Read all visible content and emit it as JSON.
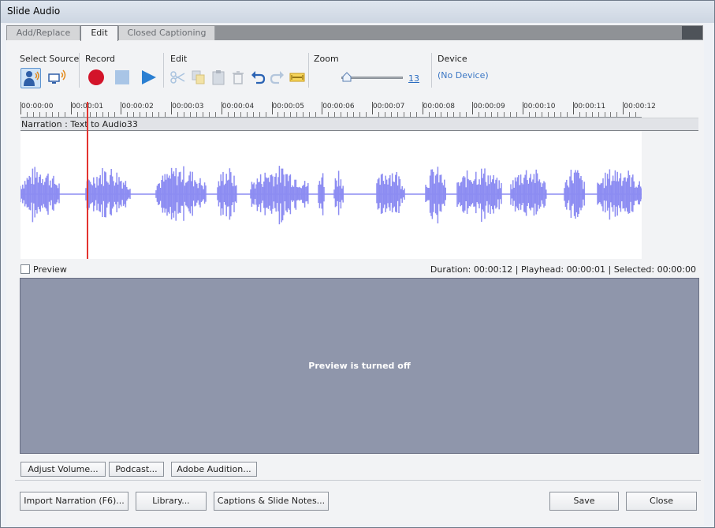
{
  "window": {
    "title": "Slide Audio"
  },
  "tabs": [
    {
      "label": "Add/Replace",
      "active": false
    },
    {
      "label": "Edit",
      "active": true
    },
    {
      "label": "Closed Captioning",
      "active": false
    }
  ],
  "toolbar": {
    "select_source_label": "Select Source",
    "record_label": "Record",
    "edit_label": "Edit",
    "zoom_label": "Zoom",
    "zoom_value": "13",
    "device_label": "Device",
    "device_value": "(No Device)"
  },
  "ruler": {
    "ticks": [
      "00:00:00",
      "00:00:01",
      "00:00:02",
      "00:00:03",
      "00:00:04",
      "00:00:05",
      "00:00:06",
      "00:00:07",
      "00:00:08",
      "00:00:09",
      "00:00:10",
      "00:00:11",
      "00:00:12"
    ]
  },
  "track": {
    "header": "Narration : Text to Audio33",
    "playhead_seconds": 1.3,
    "waveform_color": "#8c8cf2",
    "playhead_color": "#e3342f"
  },
  "preview": {
    "label": "Preview",
    "checked": false,
    "message": "Preview is turned off"
  },
  "status": {
    "duration_label": "Duration:",
    "duration_value": "00:00:12",
    "playhead_label": "| Playhead:",
    "playhead_value": "00:00:01",
    "selected_label": "| Selected:",
    "selected_value": "00:00:00"
  },
  "buttons": {
    "adjust_volume": "Adjust Volume...",
    "podcast": "Podcast...",
    "adobe_audition": "Adobe Audition...",
    "import_narration": "Import Narration (F6)...",
    "library": "Library...",
    "captions_notes": "Captions & Slide Notes...",
    "save": "Save",
    "close": "Close"
  }
}
